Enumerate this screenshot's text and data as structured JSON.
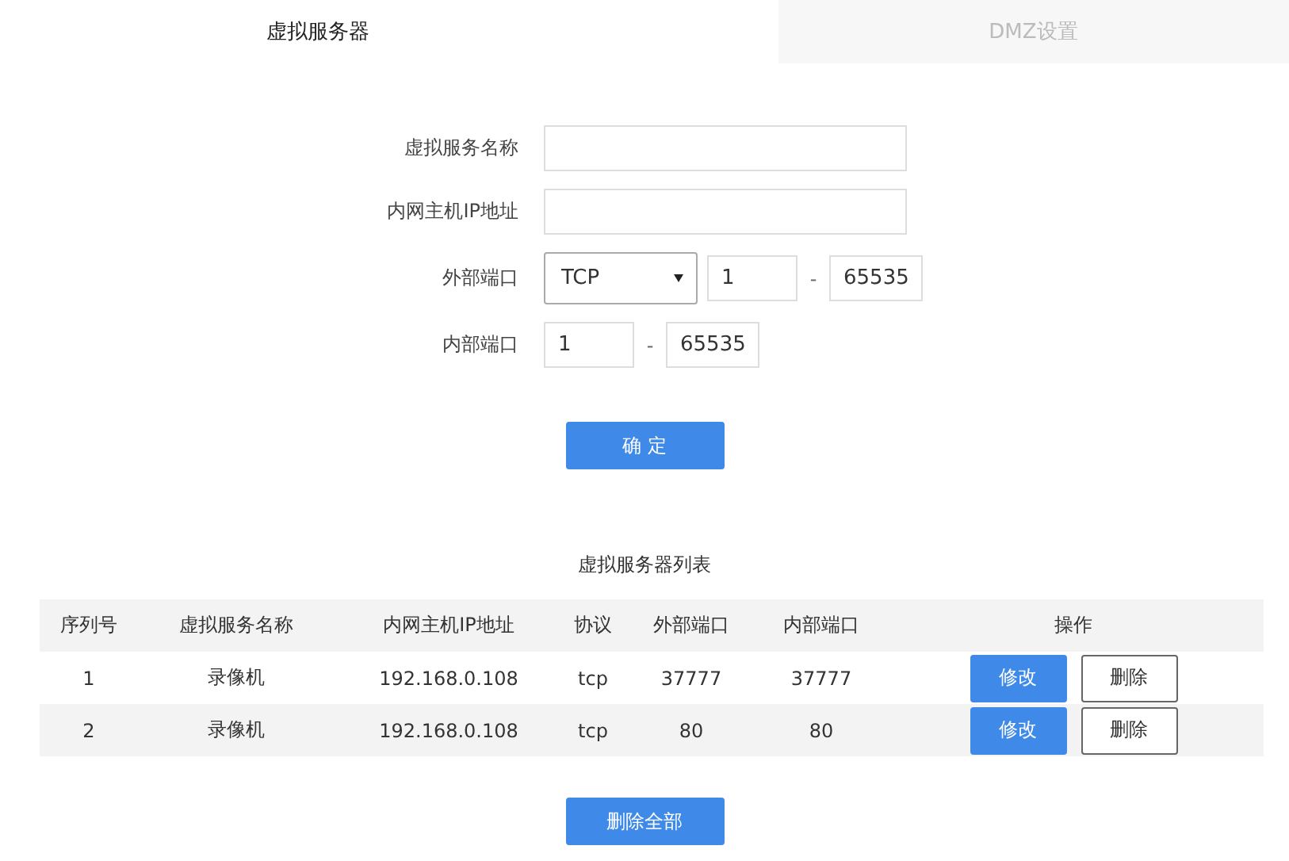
{
  "tabs": [
    {
      "label": "虚拟服务器",
      "selected": true
    },
    {
      "label": "DMZ设置",
      "selected": false
    }
  ],
  "form": {
    "rows": [
      {
        "kind": "text",
        "label": "虚拟服务名称",
        "value": ""
      },
      {
        "kind": "text",
        "label": "内网主机IP地址",
        "value": ""
      },
      {
        "kind": "protocol_range",
        "label": "外部端口",
        "protocol": "TCP",
        "from": "1",
        "separator": "-",
        "to": "65535"
      },
      {
        "kind": "range",
        "label": "内部端口",
        "from": "1",
        "separator": "-",
        "to": "65535"
      }
    ],
    "submit": "确 定"
  },
  "table": {
    "title": "虚拟服务器列表",
    "columns": [
      "序列号",
      "虚拟服务名称",
      "内网主机IP地址",
      "协议",
      "外部端口",
      "内部端口",
      "操作"
    ],
    "rows": [
      {
        "cells": [
          "1",
          "录像机",
          "192.168.0.108",
          "tcp",
          "37777",
          "37777"
        ],
        "actions": [
          "修改",
          "删除"
        ]
      },
      {
        "cells": [
          "2",
          "录像机",
          "192.168.0.108",
          "tcp",
          "80",
          "80"
        ],
        "actions": [
          "修改",
          "删除"
        ]
      }
    ],
    "delete_all": "删除全部"
  }
}
